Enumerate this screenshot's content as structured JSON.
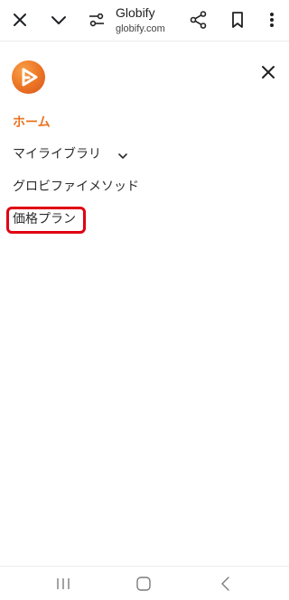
{
  "browser": {
    "site_title": "Globify",
    "site_url": "globify.com",
    "icons": [
      "close-icon",
      "chevron-down-icon",
      "page-settings-icon",
      "share-icon",
      "bookmark-icon",
      "more-vert-icon"
    ]
  },
  "menu": {
    "logo": "globify-logo",
    "items": [
      {
        "label": "ホーム",
        "active": true
      },
      {
        "label": "マイライブラリ",
        "has_submenu": true
      },
      {
        "label": "グロビファイメソッド"
      },
      {
        "label": "価格プラン",
        "highlighted": true
      }
    ]
  },
  "colors": {
    "accent": "#e8731f",
    "highlight_border": "#e00012"
  },
  "system_nav": [
    "recent-apps-icon",
    "home-icon",
    "back-icon"
  ]
}
